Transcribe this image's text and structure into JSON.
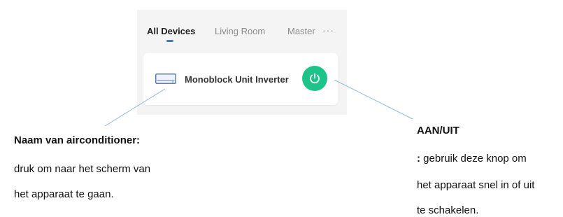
{
  "tabs": {
    "all_devices": "All Devices",
    "living_room": "Living Room",
    "master": "Master",
    "more": "···"
  },
  "device": {
    "name": "Monoblock Unit Inverter",
    "icon": "air-conditioner-icon",
    "power_icon": "power-icon",
    "power_color": "#1ec38a"
  },
  "annotations": {
    "left": {
      "title": "Naam van airconditioner:",
      "line1": "druk om naar het scherm van",
      "line2": "het apparaat te gaan."
    },
    "right": {
      "title": "AAN/UIT",
      "line1_prefix": ":",
      "line1": " gebruik deze knop om",
      "line2": "het apparaat snel in of uit",
      "line3": "te schakelen."
    }
  },
  "colors": {
    "accent": "#3b7ddd",
    "panel_bg": "#f4f4f5",
    "callout_line": "#8fb6de"
  }
}
